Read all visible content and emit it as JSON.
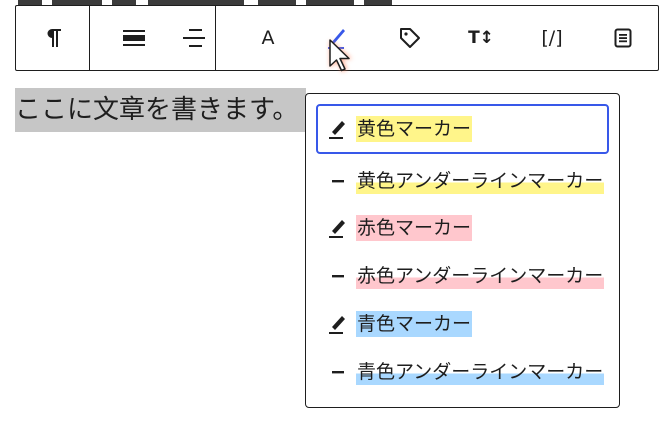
{
  "toolbar": {
    "buttons": [
      {
        "name": "paragraph-icon"
      },
      {
        "name": "align-center-icon"
      },
      {
        "name": "align-left-icon"
      },
      {
        "name": "text-color-icon",
        "label": "A"
      },
      {
        "name": "highlighter-icon",
        "accent": "#3858e9"
      },
      {
        "name": "tag-icon"
      },
      {
        "name": "text-size-icon",
        "label": "T↕"
      },
      {
        "name": "shortcode-icon",
        "label": "[/]"
      },
      {
        "name": "document-list-icon"
      }
    ]
  },
  "editor": {
    "paragraph_text": "ここに文章を書きます。"
  },
  "dropdown": {
    "items": [
      {
        "label": "黄色マーカー",
        "icon": "marker-icon",
        "style": "hl-yellow",
        "focused": true
      },
      {
        "label": "黄色アンダーラインマーカー",
        "icon": "dash-icon",
        "style": "ul-yellow"
      },
      {
        "label": "赤色マーカー",
        "icon": "marker-icon",
        "style": "hl-red"
      },
      {
        "label": "赤色アンダーラインマーカー",
        "icon": "dash-icon",
        "style": "ul-red"
      },
      {
        "label": "青色マーカー",
        "icon": "marker-icon",
        "style": "hl-blue"
      },
      {
        "label": "青色アンダーラインマーカー",
        "icon": "dash-icon",
        "style": "ul-blue"
      }
    ]
  },
  "colors": {
    "accent": "#3858e9",
    "yellow": "#fff58a",
    "red": "#ffc7cd",
    "blue": "#a9d8ff",
    "selection": "#c6c6c6",
    "cursor": "#ff8a65"
  }
}
